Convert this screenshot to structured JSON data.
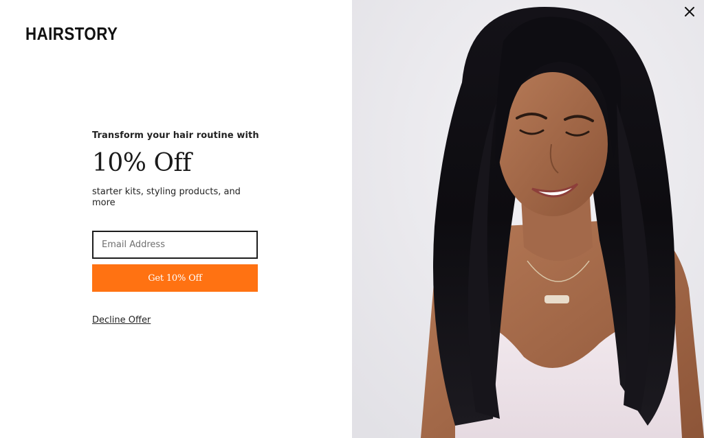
{
  "brand": {
    "logo_text": "HAIRSTORY"
  },
  "offer": {
    "eyebrow": "Transform your hair routine with",
    "headline": "10% Off",
    "subtext": "starter kits, styling products, and more"
  },
  "form": {
    "email_placeholder": "Email Address",
    "email_value": "",
    "submit_label": "Get 10% Off"
  },
  "decline": {
    "label": "Decline Offer"
  },
  "close": {
    "icon": "close-icon"
  },
  "image": {
    "subject": "hero-photo"
  },
  "colors": {
    "accent": "#ff7212",
    "text": "#1a1a1a",
    "background": "#ffffff",
    "photo_background": "#e8e7eb"
  }
}
